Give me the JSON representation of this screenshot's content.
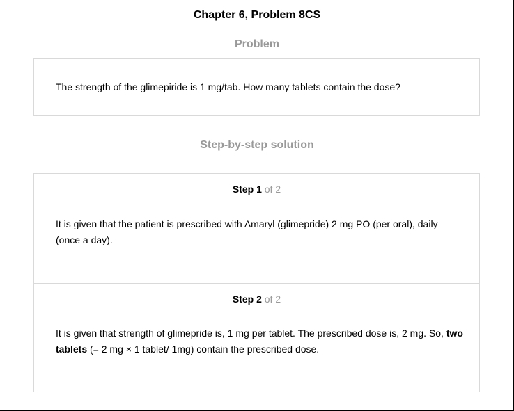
{
  "title": "Chapter 6, Problem 8CS",
  "problem": {
    "heading": "Problem",
    "text": "The strength of the glimepiride is 1 mg/tab. How many tablets contain the dose?"
  },
  "solution": {
    "heading": "Step-by-step solution",
    "steps": [
      {
        "label": "Step 1",
        "of": " of 2",
        "text": "It is given that the patient is prescribed with Amaryl (glimepride) 2 mg PO (per oral), daily (once a day)."
      },
      {
        "label": "Step 2",
        "of": " of 2",
        "text_before": "It is given that strength of glimepride is, 1 mg per tablet. The prescribed dose is, 2 mg. So, ",
        "text_bold": "two tablets",
        "text_after": " (= 2 mg × 1 tablet/ 1mg) contain the prescribed dose."
      }
    ]
  }
}
